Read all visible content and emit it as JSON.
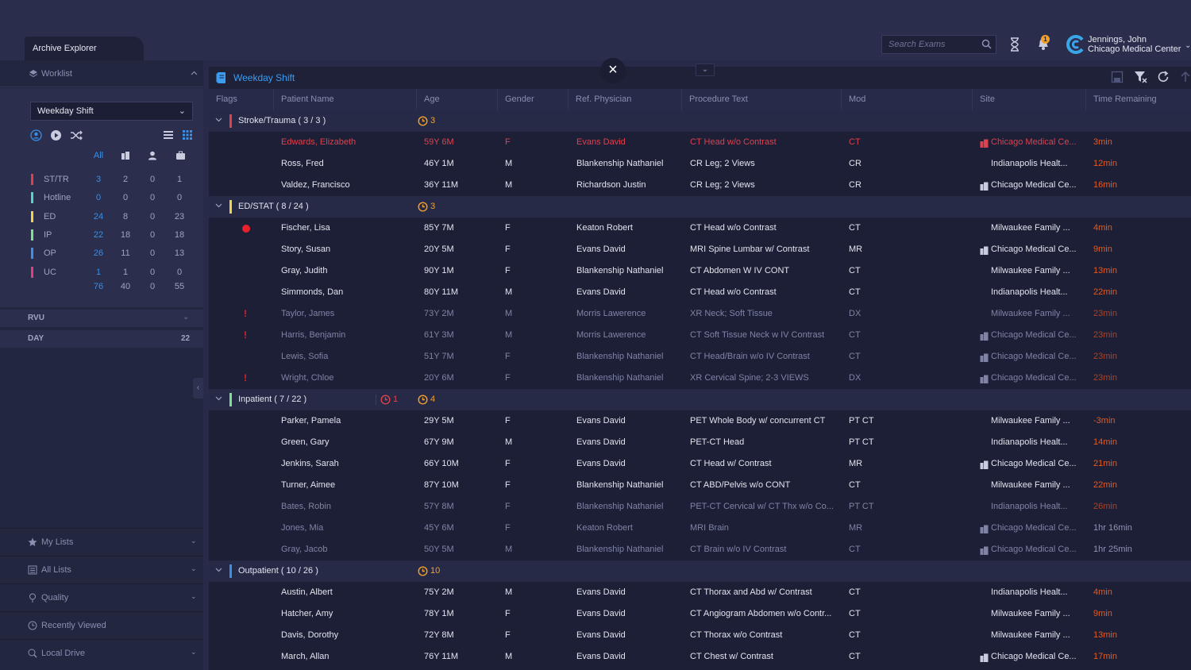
{
  "app": {
    "tab": "Archive Explorer"
  },
  "header": {
    "search_placeholder": "Search Exams",
    "notification_count": "1",
    "user_name": "Jennings, John",
    "user_site": "Chicago Medical Center"
  },
  "sidebar": {
    "worklist_label": "Worklist",
    "shift_select": "Weekday Shift",
    "stats_header": {
      "all": "All"
    },
    "stats": [
      {
        "name": "ST/TR",
        "color": "#e0404c",
        "all": "3",
        "c2": "2",
        "c3": "0",
        "c4": "1"
      },
      {
        "name": "Hotline",
        "color": "#4fd6c6",
        "all": "0",
        "c2": "0",
        "c3": "0",
        "c4": "0"
      },
      {
        "name": "ED",
        "color": "#f0d34a",
        "all": "24",
        "c2": "8",
        "c3": "0",
        "c4": "23"
      },
      {
        "name": "IP",
        "color": "#7de08a",
        "all": "22",
        "c2": "18",
        "c3": "0",
        "c4": "18"
      },
      {
        "name": "OP",
        "color": "#3b8fe6",
        "all": "26",
        "c2": "11",
        "c3": "0",
        "c4": "13"
      },
      {
        "name": "UC",
        "color": "#e0407a",
        "all": "1",
        "c2": "1",
        "c3": "0",
        "c4": "0"
      }
    ],
    "totals": {
      "all": "76",
      "c2": "40",
      "c3": "0",
      "c4": "55"
    },
    "rvu_label": "RVU",
    "day_label": "DAY",
    "day_value": "22",
    "accordions": [
      "My Lists",
      "All Lists",
      "Quality",
      "Recently Viewed",
      "Local Drive"
    ]
  },
  "main": {
    "title": "Weekday Shift",
    "columns": [
      "Flags",
      "Patient Name",
      "Age",
      "Gender",
      "Ref. Physician",
      "Procedure Text",
      "Mod",
      "Site",
      "Time Remaining"
    ]
  },
  "groups": [
    {
      "label": "Stroke/Trauma ( 3 / 3 )",
      "color": "#e0404c",
      "clock": "3",
      "clock_red": "",
      "rows": [
        {
          "style": "r",
          "flag": "",
          "name": "Edwards, Elizabeth",
          "age": "59Y 6M",
          "gender": "F",
          "phys": "Evans David",
          "proc": "CT Head w/o Contrast",
          "mod": "CT",
          "site": "Chicago Medical Ce...",
          "site_icon": true,
          "time": "3min",
          "time_blue": false
        },
        {
          "style": "n",
          "flag": "",
          "name": "Ross, Fred",
          "age": "46Y 1M",
          "gender": "M",
          "phys": "Blankenship Nathaniel",
          "proc": "CR Leg; 2 Views",
          "mod": "CR",
          "site": "Indianapolis Healt...",
          "site_icon": false,
          "time": "12min",
          "time_blue": false
        },
        {
          "style": "n",
          "flag": "",
          "name": "Valdez, Francisco",
          "age": "36Y 11M",
          "gender": "M",
          "phys": "Richardson Justin",
          "proc": "CR Leg; 2 Views",
          "mod": "CR",
          "site": "Chicago Medical Ce...",
          "site_icon": true,
          "time": "16min",
          "time_blue": false
        }
      ]
    },
    {
      "label": "ED/STAT ( 8 / 24 )",
      "color": "#f0d34a",
      "clock": "3",
      "clock_red": "",
      "rows": [
        {
          "style": "n",
          "flag": "dot",
          "name": "Fischer, Lisa",
          "age": "85Y 7M",
          "gender": "F",
          "phys": "Keaton Robert",
          "proc": "CT Head w/o Contrast",
          "mod": "CT",
          "site": "Milwaukee Family ...",
          "site_icon": false,
          "time": "4min",
          "time_blue": false
        },
        {
          "style": "n",
          "flag": "",
          "name": "Story, Susan",
          "age": "20Y 5M",
          "gender": "F",
          "phys": "Evans David",
          "proc": "MRI Spine Lumbar w/ Contrast",
          "mod": "MR",
          "site": "Chicago Medical Ce...",
          "site_icon": true,
          "time": "9min",
          "time_blue": false
        },
        {
          "style": "n",
          "flag": "",
          "name": "Gray, Judith",
          "age": "90Y 1M",
          "gender": "F",
          "phys": "Blankenship Nathaniel",
          "proc": "CT Abdomen W IV CONT",
          "mod": "CT",
          "site": "Milwaukee Family ...",
          "site_icon": false,
          "time": "13min",
          "time_blue": false
        },
        {
          "style": "n",
          "flag": "",
          "name": "Simmonds, Dan",
          "age": "80Y 11M",
          "gender": "M",
          "phys": "Evans David",
          "proc": "CT Head w/o Contrast",
          "mod": "CT",
          "site": "Indianapolis Healt...",
          "site_icon": false,
          "time": "22min",
          "time_blue": false
        },
        {
          "style": "d",
          "flag": "ex",
          "name": "Taylor, James",
          "age": "73Y 2M",
          "gender": "M",
          "phys": "Morris Lawerence",
          "proc": "XR Neck; Soft Tissue",
          "mod": "DX",
          "site": "Milwaukee Family ...",
          "site_icon": false,
          "time": "23min",
          "time_blue": false
        },
        {
          "style": "d",
          "flag": "ex",
          "name": "Harris, Benjamin",
          "age": "61Y 3M",
          "gender": "M",
          "phys": "Morris Lawerence",
          "proc": "CT Soft Tissue Neck w IV Contrast",
          "mod": "CT",
          "site": "Chicago Medical Ce...",
          "site_icon": true,
          "time": "23min",
          "time_blue": false
        },
        {
          "style": "d",
          "flag": "",
          "name": "Lewis, Sofia",
          "age": "51Y 7M",
          "gender": "F",
          "phys": "Blankenship Nathaniel",
          "proc": "CT Head/Brain w/o IV Contrast",
          "mod": "CT",
          "site": "Chicago Medical Ce...",
          "site_icon": true,
          "time": "23min",
          "time_blue": false
        },
        {
          "style": "d",
          "flag": "ex",
          "name": "Wright, Chloe",
          "age": "20Y 6M",
          "gender": "F",
          "phys": "Blankenship Nathaniel",
          "proc": "XR Cervical Spine; 2-3 VIEWS",
          "mod": "DX",
          "site": "Chicago Medical Ce...",
          "site_icon": true,
          "time": "23min",
          "time_blue": false
        }
      ]
    },
    {
      "label": "Inpatient ( 7 / 22 )",
      "color": "#7de08a",
      "clock": "4",
      "clock_red": "1",
      "rows": [
        {
          "style": "n",
          "flag": "",
          "name": "Parker, Pamela",
          "age": "29Y 5M",
          "gender": "F",
          "phys": "Evans David",
          "proc": "PET Whole Body w/ concurrent CT",
          "mod": "PT CT",
          "site": "Milwaukee Family ...",
          "site_icon": false,
          "time": "-3min",
          "time_blue": false
        },
        {
          "style": "n",
          "flag": "",
          "name": "Green, Gary",
          "age": "67Y 9M",
          "gender": "M",
          "phys": "Evans David",
          "proc": "PET-CT Head",
          "mod": "PT CT",
          "site": "Indianapolis Healt...",
          "site_icon": false,
          "time": "14min",
          "time_blue": false
        },
        {
          "style": "n",
          "flag": "",
          "name": "Jenkins, Sarah",
          "age": "66Y 10M",
          "gender": "F",
          "phys": "Evans David",
          "proc": "CT Head w/ Contrast",
          "mod": "MR",
          "site": "Chicago Medical Ce...",
          "site_icon": true,
          "time": "21min",
          "time_blue": false
        },
        {
          "style": "n",
          "flag": "",
          "name": "Turner, Aimee",
          "age": "87Y 10M",
          "gender": "F",
          "phys": "Blankenship Nathaniel",
          "proc": "CT ABD/Pelvis w/o CONT",
          "mod": "CT",
          "site": "Milwaukee Family ...",
          "site_icon": false,
          "time": "22min",
          "time_blue": false
        },
        {
          "style": "d",
          "flag": "",
          "name": "Bates, Robin",
          "age": "57Y 8M",
          "gender": "F",
          "phys": "Blankenship Nathaniel",
          "proc": "PET-CT Cervical w/ CT Thx w/o Co...",
          "mod": "PT CT",
          "site": "Indianapolis Healt...",
          "site_icon": false,
          "time": "26min",
          "time_blue": false
        },
        {
          "style": "d",
          "flag": "",
          "name": "Jones, Mia",
          "age": "45Y 6M",
          "gender": "F",
          "phys": "Keaton Robert",
          "proc": "MRI Brain",
          "mod": "MR",
          "site": "Chicago Medical Ce...",
          "site_icon": true,
          "time": "1hr 16min",
          "time_blue": true
        },
        {
          "style": "d",
          "flag": "",
          "name": "Gray, Jacob",
          "age": "50Y 5M",
          "gender": "M",
          "phys": "Blankenship Nathaniel",
          "proc": "CT Brain w/o IV Contrast",
          "mod": "CT",
          "site": "Chicago Medical Ce...",
          "site_icon": true,
          "time": "1hr 25min",
          "time_blue": true
        }
      ]
    },
    {
      "label": "Outpatient ( 10 / 26 )",
      "color": "#3b8fe6",
      "clock": "10",
      "clock_red": "",
      "rows": [
        {
          "style": "n",
          "flag": "",
          "name": "Austin, Albert",
          "age": "75Y 2M",
          "gender": "M",
          "phys": "Evans David",
          "proc": "CT Thorax and Abd w/ Contrast",
          "mod": "CT",
          "site": "Indianapolis Healt...",
          "site_icon": false,
          "time": "4min",
          "time_blue": false
        },
        {
          "style": "n",
          "flag": "",
          "name": "Hatcher, Amy",
          "age": "78Y 1M",
          "gender": "F",
          "phys": "Evans David",
          "proc": "CT Angiogram Abdomen w/o Contr...",
          "mod": "CT",
          "site": "Milwaukee Family ...",
          "site_icon": false,
          "time": "9min",
          "time_blue": false
        },
        {
          "style": "n",
          "flag": "",
          "name": "Davis, Dorothy",
          "age": "72Y 8M",
          "gender": "F",
          "phys": "Evans David",
          "proc": "CT Thorax w/o Contrast",
          "mod": "CT",
          "site": "Milwaukee Family ...",
          "site_icon": false,
          "time": "13min",
          "time_blue": false
        },
        {
          "style": "n",
          "flag": "",
          "name": "March, Allan",
          "age": "76Y 11M",
          "gender": "M",
          "phys": "Evans David",
          "proc": "CT Chest w/ Contrast",
          "mod": "CT",
          "site": "Chicago Medical Ce...",
          "site_icon": true,
          "time": "17min",
          "time_blue": false
        }
      ]
    }
  ]
}
